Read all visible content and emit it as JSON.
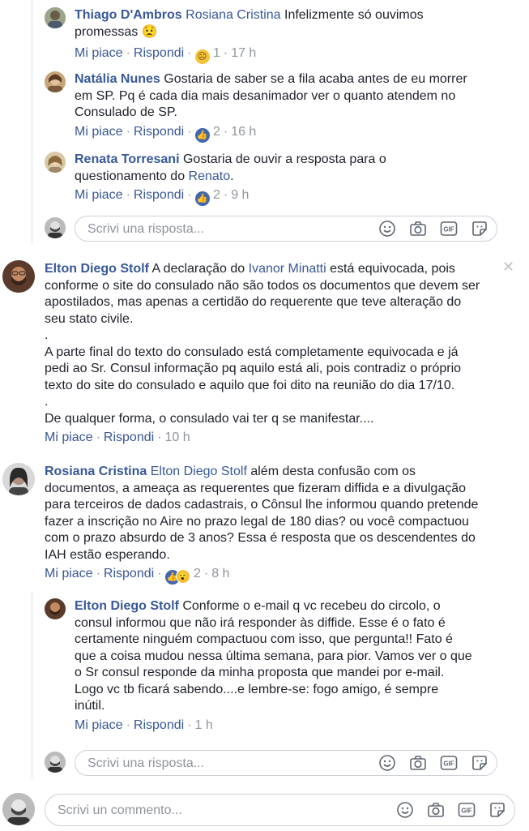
{
  "common": {
    "like": "Mi piace",
    "reply": "Rispondi",
    "sep": "·"
  },
  "comments": [
    {
      "name": "Thiago D'Ambros",
      "mention": "Rosiana Cristina",
      "text_a": " Infelizmente só ouvimos",
      "text_b": "promessas",
      "emoji": "😟",
      "reaction_count": "1",
      "time": "17 h"
    },
    {
      "name": "Natália Nunes",
      "lines": [
        " Gostaria de saber se a fila acaba antes de eu morrer",
        "em SP. Pq é cada dia mais desanimador ver o quanto atendem no",
        "Consulado de SP."
      ],
      "reaction_count": "2",
      "time": "16 h"
    },
    {
      "name": "Renata Torresani",
      "line1": " Gostaria de ouvir a resposta para o",
      "line2a": "questionamento do ",
      "mention": "Renato",
      "line2b": ".",
      "reaction_count": "2",
      "time": "9 h"
    },
    {
      "name": "Elton Diego Stolf",
      "l1a": " A declaração do ",
      "mention": "Ivanor Minatti",
      "l1b": " está equivocada, pois",
      "lines": [
        "conforme o site do consulado não são todos os documentos que devem ser",
        "apostilados, mas apenas a certidão do requerente que teve alteração do",
        "seu stato civile.",
        ".",
        "A parte final do texto do consulado está completamente equivocada e já",
        "pedi ao Sr. Consul informação pq aquilo está ali, pois contradiz o próprio",
        "texto do site do consulado e aquilo que foi dito na reunião do dia 17/10.",
        ".",
        "De qualquer forma, o consulado vai ter q se manifestar...."
      ],
      "time": "10 h"
    },
    {
      "name": "Rosiana Cristina",
      "mention": "Elton Diego Stolf",
      "l1b": " além desta confusão com os",
      "lines": [
        "documentos, a ameaça as requerentes que fizeram diffida e a divulgação",
        "para terceiros de dados cadastrais, o Cônsul lhe informou quando pretende",
        "fazer a inscrição no Aire no prazo legal de 180 dias? ou você compactuou",
        "com o prazo absurdo de 3 anos? Essa é resposta que os descendentes do",
        "IAH estão esperando."
      ],
      "reaction_count": "2",
      "time": "8 h"
    },
    {
      "name": "Elton Diego Stolf",
      "l1b": " Conforme o e-mail q vc recebeu do circolo, o",
      "lines": [
        "consul informou que não irá responder às diffide. Esse é o fato é",
        "certamente ninguém compactuou com isso, que pergunta!! Fato é",
        "que a coisa mudou nessa última semana, para pior. Vamos ver o que",
        "o Sr consul responde da minha proposta que mandei por e-mail.",
        "Logo vc tb ficará sabendo....e lembre-se: fogo amigo, é sempre",
        "inútil."
      ],
      "time": "1 h"
    }
  ],
  "reply_placeholder": "Scrivi una risposta...",
  "comment_placeholder": "Scrivi un commento...",
  "gif_label": "GIF",
  "colors": {
    "link": "#385898",
    "meta": "#90949c",
    "like": "#4267b2",
    "border": "#ccd0d5"
  }
}
